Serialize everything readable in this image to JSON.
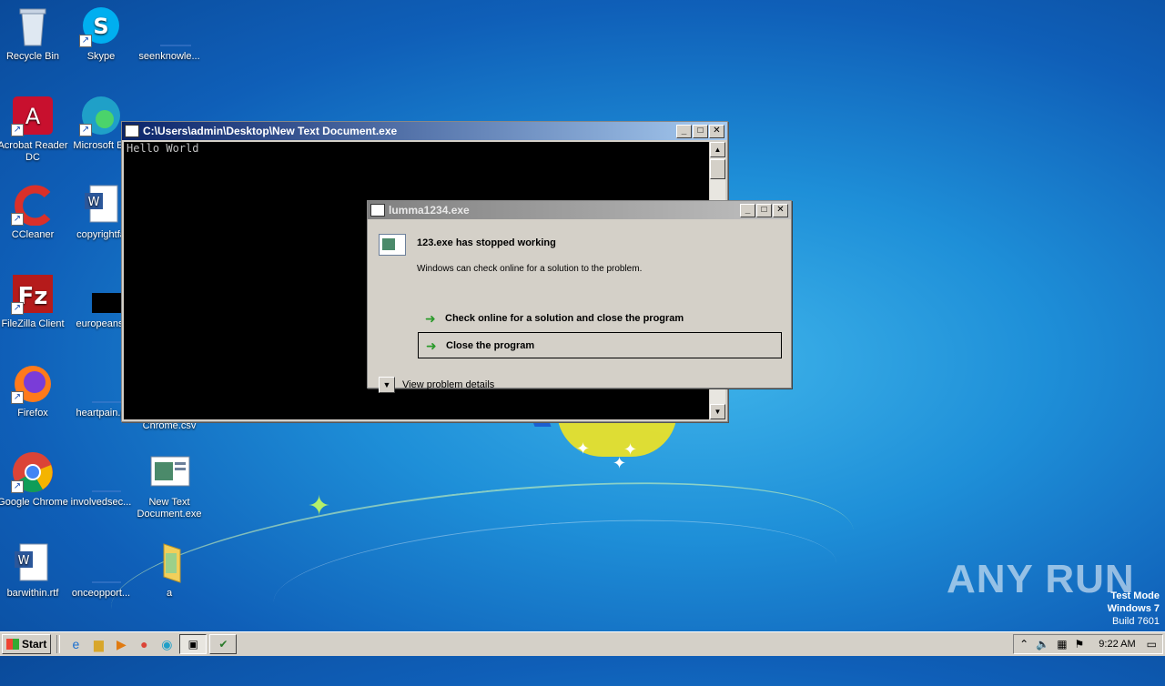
{
  "desktop": {
    "icons": [
      {
        "label": "Recycle Bin"
      },
      {
        "label": "Skype"
      },
      {
        "label": "seenknowle..."
      },
      {
        "label": "Acrobat Reader DC"
      },
      {
        "label": "Microsoft Ed"
      },
      {
        "label": "CCleaner"
      },
      {
        "label": "copyrightfa"
      },
      {
        "label": "FileZilla Client"
      },
      {
        "label": "europeanst"
      },
      {
        "label": "Firefox"
      },
      {
        "label": "heartpain.p"
      },
      {
        "label": "Chrome.csv"
      },
      {
        "label": "Google Chrome"
      },
      {
        "label": "involvedsec..."
      },
      {
        "label": "New Text Document.exe"
      },
      {
        "label": "barwithin.rtf"
      },
      {
        "label": "onceopport..."
      },
      {
        "label": "a"
      }
    ]
  },
  "console": {
    "title": "C:\\Users\\admin\\Desktop\\New Text Document.exe",
    "output": "Hello World"
  },
  "dialog": {
    "title": "lumma1234.exe",
    "heading": "123.exe has stopped working",
    "subtext": "Windows can check online for a solution to the problem.",
    "option_check": "Check online for a solution and close the program",
    "option_close": "Close the program",
    "details": "View problem details"
  },
  "watermark": {
    "brand": "ANY RUN",
    "mode_line1": "Test Mode",
    "mode_line2": "Windows 7",
    "mode_line3": "Build 7601"
  },
  "taskbar": {
    "start_label": "Start",
    "clock": "9:22 AM"
  }
}
